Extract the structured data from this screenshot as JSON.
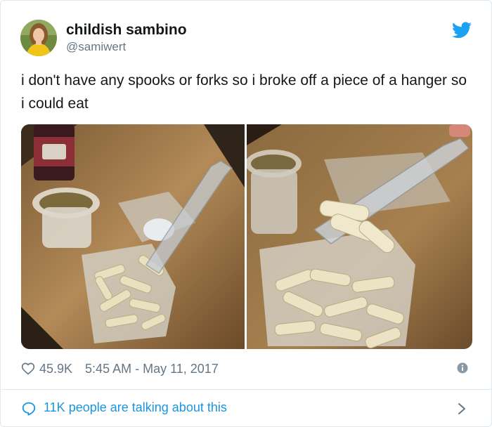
{
  "tweet": {
    "author": {
      "display_name": "childish sambino",
      "handle": "@samiwert"
    },
    "text": "i don't have any spooks or forks so i broke off a piece of a hanger so i could eat",
    "likes": "45.9K",
    "timestamp": "5:45 AM - May 11, 2017",
    "conversation_text": "11K people are talking about this"
  },
  "icons": {
    "brand": "twitter-bird-icon",
    "like": "heart-icon",
    "info": "info-icon",
    "reply": "speech-bubble-icon",
    "more": "chevron-right-icon"
  },
  "colors": {
    "twitter_blue": "#1da1f2",
    "link_blue": "#1b95e0",
    "secondary_text": "#657786",
    "border": "#e1e8ed"
  }
}
